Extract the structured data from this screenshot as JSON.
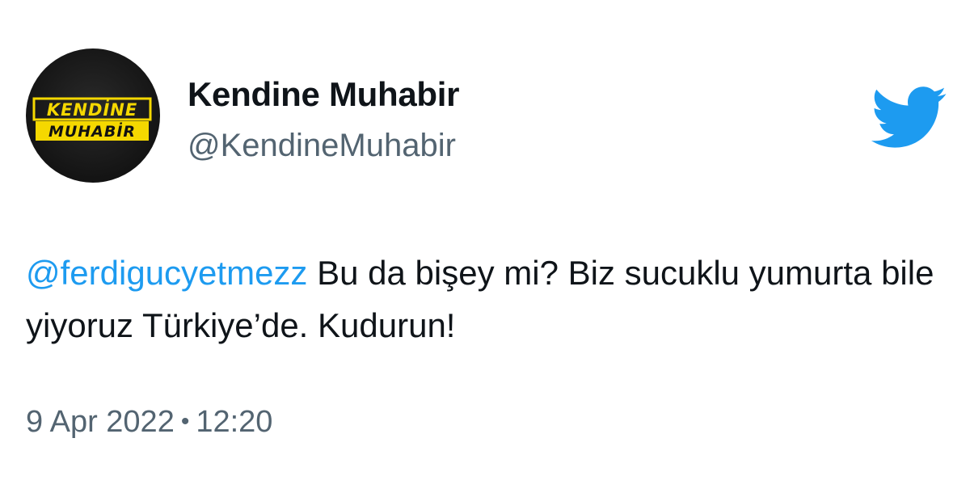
{
  "author": {
    "display_name": "Kendine Muhabir",
    "handle": "@KendineMuhabir",
    "avatar_logo": {
      "line1": "KENDİNE",
      "line2": "MUHABİR",
      "bg_color": "#1a1a1a",
      "accent_color": "#f5d800"
    }
  },
  "brand": {
    "icon": "twitter-bird-icon",
    "color": "#1d9bf0"
  },
  "tweet": {
    "mention": "@ferdigucyetmezz",
    "text_after_mention": " Bu da bişey mi? Biz sucuklu yumurta bile yiyoruz Türkiye’de. Kudurun!",
    "date": "9 Apr 2022",
    "separator": "•",
    "time": "12:20"
  }
}
